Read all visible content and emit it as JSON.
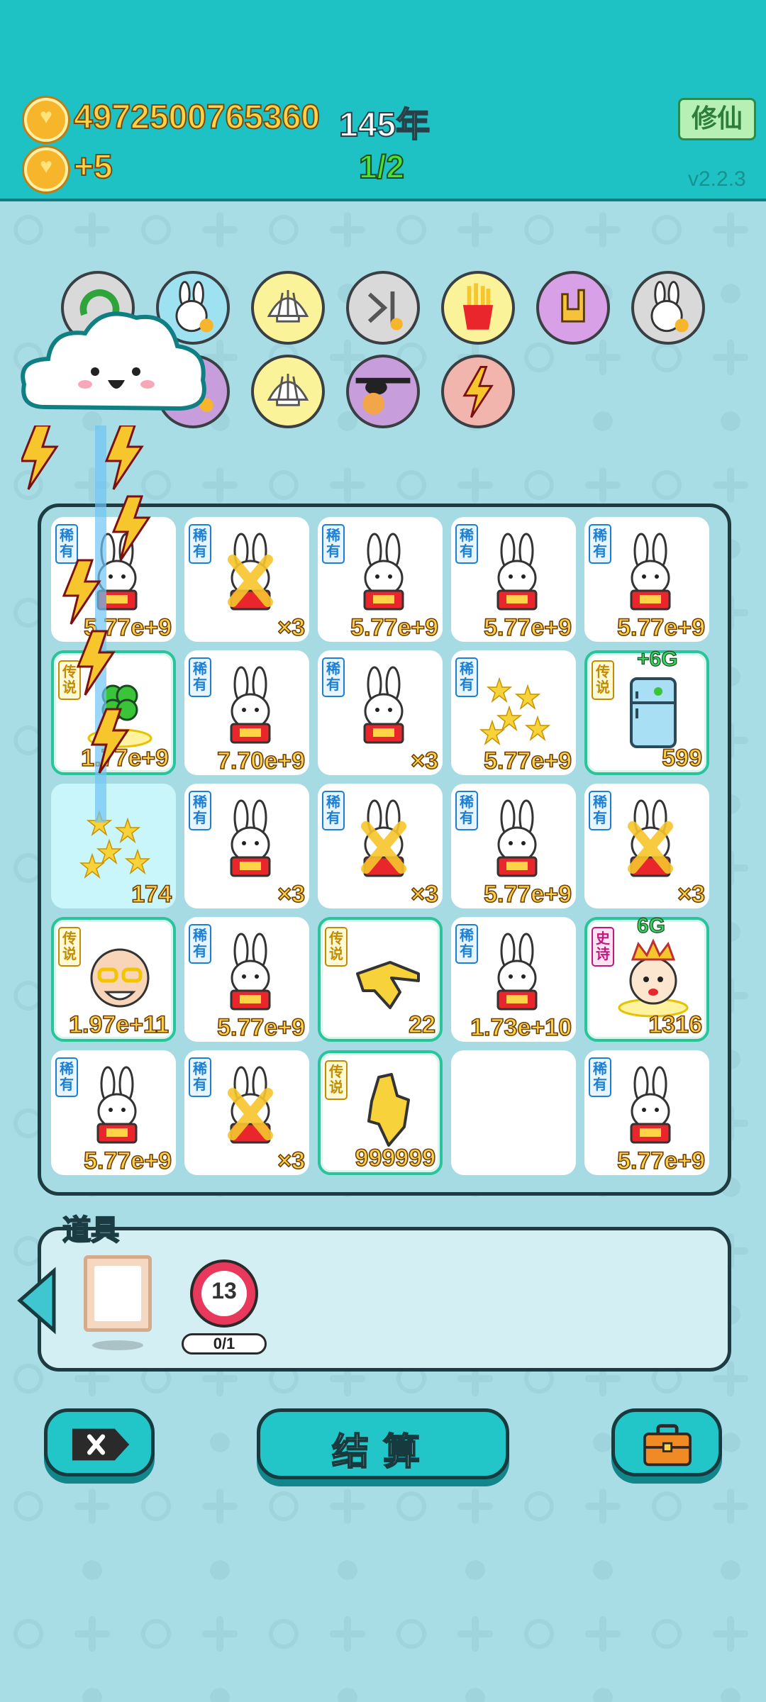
{
  "header": {
    "coins": "4972500765360",
    "year": "145年",
    "income": "+5",
    "wave": "1/2",
    "xiuxian_label": "修仙",
    "version": "v2.2.3"
  },
  "relics": [
    {
      "name": "refresh"
    },
    {
      "name": "rabbit"
    },
    {
      "name": "shell"
    },
    {
      "name": "skip"
    },
    {
      "name": "fries"
    },
    {
      "name": "rock-hand"
    },
    {
      "name": "rabbit"
    },
    {
      "name": "purple"
    },
    {
      "name": "shell"
    },
    {
      "name": "eyepatch-peach"
    },
    {
      "name": "lightning"
    }
  ],
  "board": {
    "rows": [
      [
        {
          "tag": "稀有",
          "rarity": "rare",
          "icon": "rabbit",
          "value": "5.77e+9"
        },
        {
          "tag": "稀有",
          "rarity": "rare",
          "icon": "rabbit-crossed",
          "value": "×3"
        },
        {
          "tag": "稀有",
          "rarity": "rare",
          "icon": "rabbit",
          "value": "5.77e+9"
        },
        {
          "tag": "稀有",
          "rarity": "rare",
          "icon": "rabbit",
          "value": "5.77e+9"
        },
        {
          "tag": "稀有",
          "rarity": "rare",
          "icon": "rabbit",
          "value": "5.77e+9"
        }
      ],
      [
        {
          "tag": "传说",
          "rarity": "legendary",
          "icon": "clover",
          "value": "1.77e+9"
        },
        {
          "tag": "稀有",
          "rarity": "rare",
          "icon": "rabbit",
          "value": "7.70e+9"
        },
        {
          "tag": "稀有",
          "rarity": "rare",
          "icon": "rabbit",
          "value": "×3"
        },
        {
          "tag": "稀有",
          "rarity": "rare",
          "icon": "stars",
          "value": "5.77e+9"
        },
        {
          "tag": "传说",
          "rarity": "legendary",
          "icon": "fridge",
          "value": "599",
          "badge": "+6G"
        }
      ],
      [
        {
          "tag": "",
          "rarity": "glow",
          "icon": "stars",
          "value": "174"
        },
        {
          "tag": "稀有",
          "rarity": "rare",
          "icon": "rabbit",
          "value": "×3"
        },
        {
          "tag": "稀有",
          "rarity": "rare",
          "icon": "rabbit-crossed",
          "value": "×3"
        },
        {
          "tag": "稀有",
          "rarity": "rare",
          "icon": "rabbit",
          "value": "5.77e+9"
        },
        {
          "tag": "稀有",
          "rarity": "rare",
          "icon": "rabbit-crossed",
          "value": "×3"
        }
      ],
      [
        {
          "tag": "传说",
          "rarity": "legendary",
          "icon": "old-man",
          "value": "1.97e+11"
        },
        {
          "tag": "稀有",
          "rarity": "rare",
          "icon": "rabbit",
          "value": "5.77e+9"
        },
        {
          "tag": "传说",
          "rarity": "legendary",
          "icon": "hand-point",
          "value": "22"
        },
        {
          "tag": "稀有",
          "rarity": "rare",
          "icon": "rabbit",
          "value": "1.73e+10"
        },
        {
          "tag": "史诗",
          "rarity": "epic",
          "icon": "king",
          "value": "1316",
          "badge": "6G"
        }
      ],
      [
        {
          "tag": "稀有",
          "rarity": "rare",
          "icon": "rabbit",
          "value": "5.77e+9"
        },
        {
          "tag": "稀有",
          "rarity": "rare",
          "icon": "rabbit-crossed",
          "value": "×3"
        },
        {
          "tag": "传说",
          "rarity": "legendary",
          "icon": "hand-down",
          "value": "999999"
        },
        {
          "tag": "",
          "rarity": "empty",
          "icon": "",
          "value": ""
        },
        {
          "tag": "稀有",
          "rarity": "rare",
          "icon": "rabbit",
          "value": "5.77e+9"
        }
      ]
    ]
  },
  "items": {
    "title": "道具",
    "frame_item": "frame",
    "target_value": "13",
    "target_count": "0/1"
  },
  "buttons": {
    "cancel_icon": "close-tag-icon",
    "settle_label": "结算",
    "bag_icon": "briefcase-icon"
  },
  "colors": {
    "header": "#1ec1c4",
    "background": "#a9dde6",
    "coin_text": "#ffd347",
    "wave": "#4ddf3a",
    "button": "#22c6c8"
  }
}
